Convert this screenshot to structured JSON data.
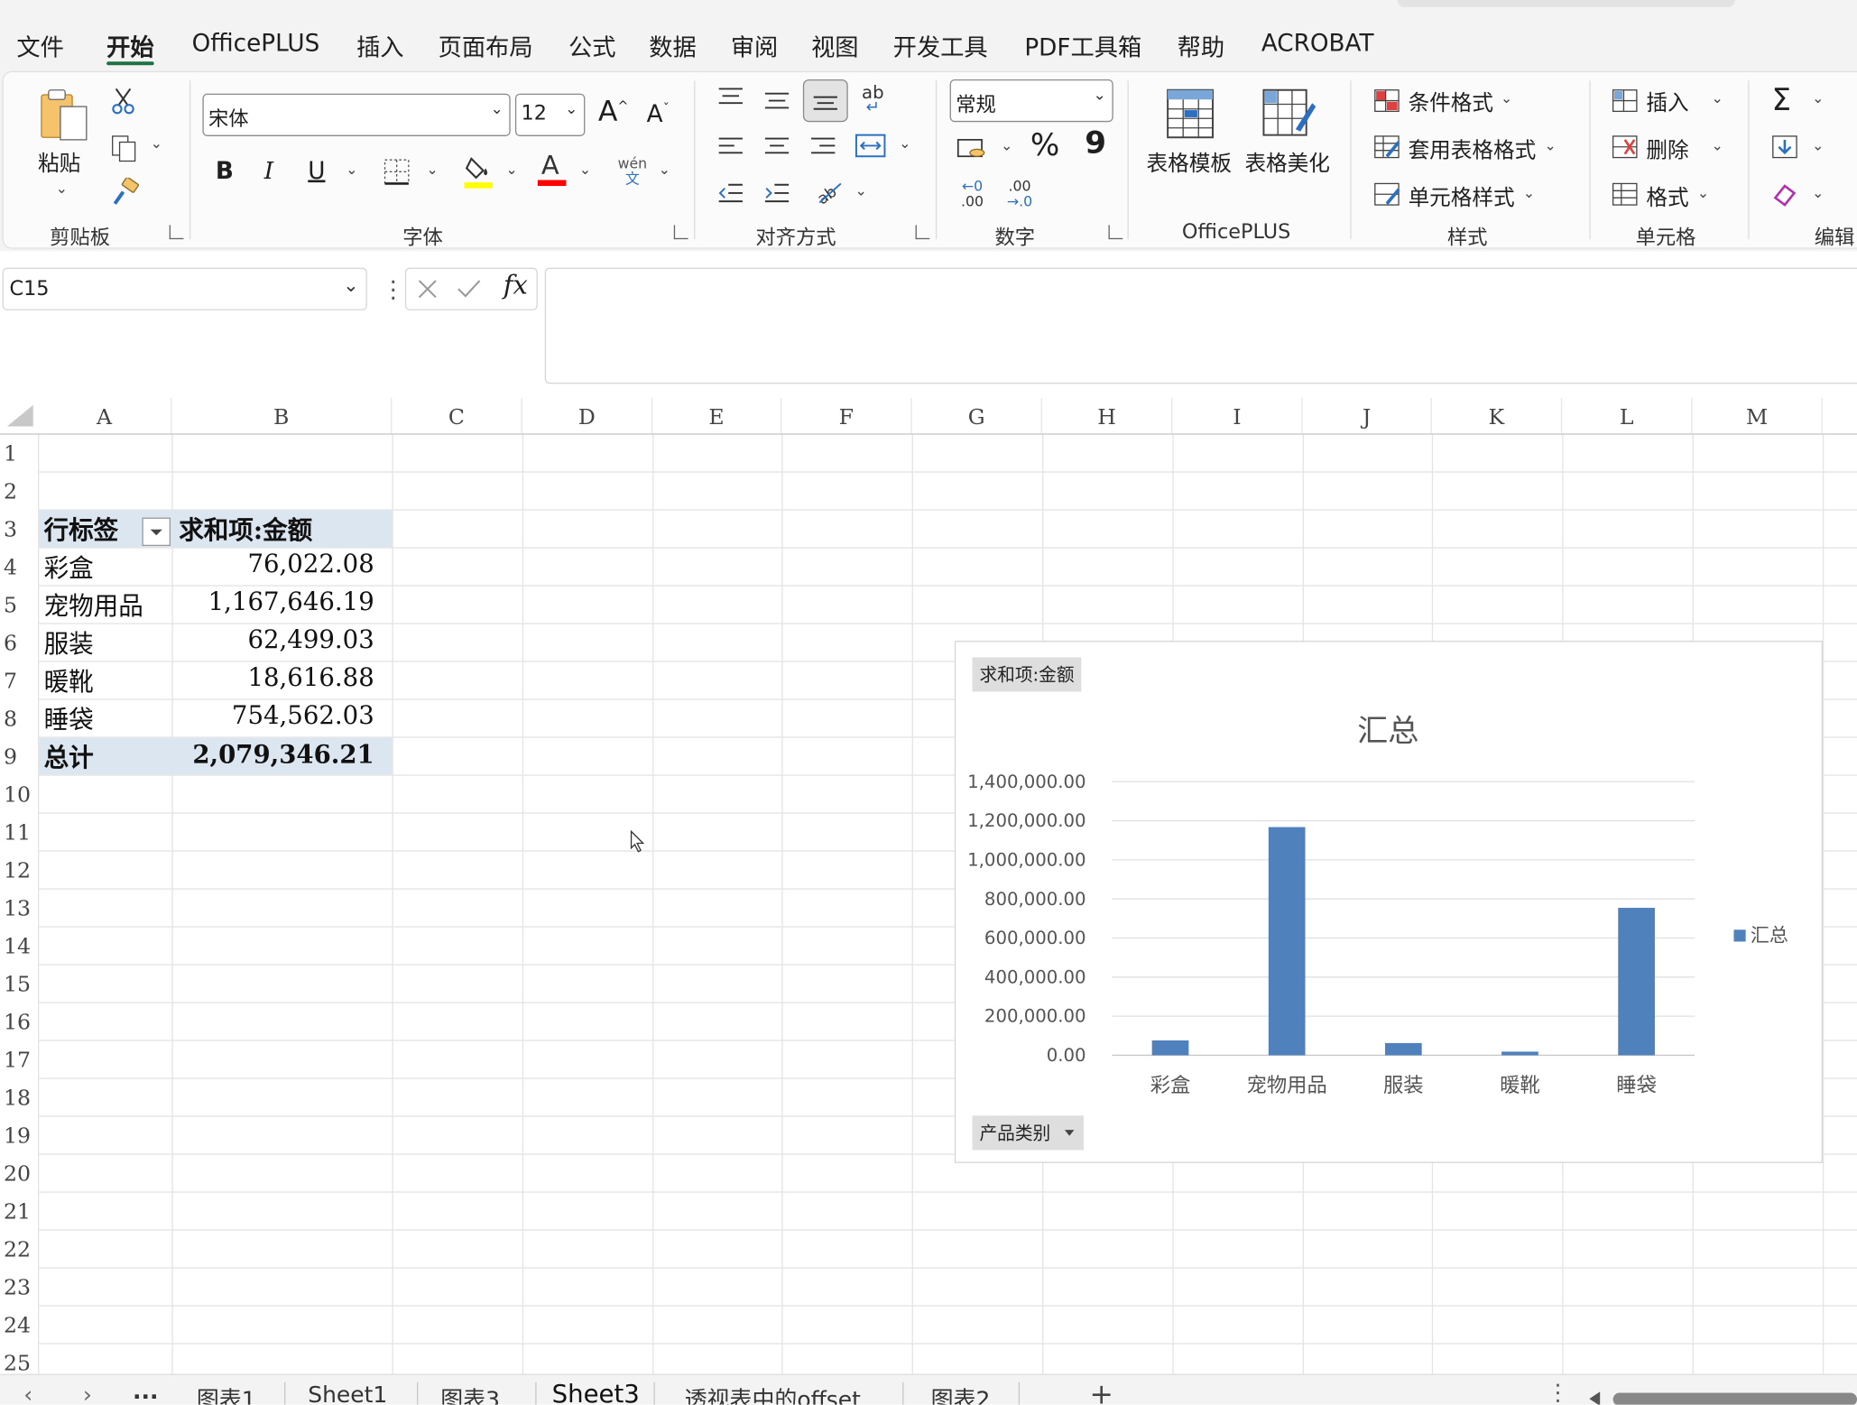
{
  "menu": {
    "items": [
      "文件",
      "开始",
      "OfficePLUS",
      "插入",
      "页面布局",
      "公式",
      "数据",
      "审阅",
      "视图",
      "开发工具",
      "PDF工具箱",
      "帮助",
      "ACROBAT"
    ],
    "active_index": 1
  },
  "ribbon": {
    "clipboard": {
      "paste_label": "粘贴",
      "group_label": "剪贴板"
    },
    "font": {
      "font_name": "宋体",
      "font_size": "12",
      "bold": "B",
      "italic": "I",
      "underline": "U",
      "font_color_glyph": "A",
      "phonetic_top": "wén",
      "phonetic_bottom": "文",
      "grow": "A",
      "shrink": "A",
      "group_label": "字体"
    },
    "alignment": {
      "wrap_glyph": "ab",
      "group_label": "对齐方式"
    },
    "number": {
      "format": "常规",
      "percent": "%",
      "comma": "9",
      "dec_inc_top": "←0",
      "dec_inc_bottom": ".00",
      "dec_dec_top": ".00",
      "dec_dec_bottom": "→.0",
      "group_label": "数字"
    },
    "officeplus": {
      "table_template": "表格模板",
      "table_beautify": "表格美化",
      "group_label": "OfficePLUS"
    },
    "styles": {
      "conditional": "条件格式",
      "table_format": "套用表格格式",
      "cell_styles": "单元格样式",
      "group_label": "样式"
    },
    "cells": {
      "insert": "插入",
      "delete": "删除",
      "format": "格式",
      "group_label": "单元格"
    },
    "editing": {
      "sum": "Σ",
      "group_label": "编辑"
    }
  },
  "formula_bar": {
    "name_box": "C15",
    "fx": "fx",
    "content": ""
  },
  "columns": [
    "A",
    "B",
    "C",
    "D",
    "E",
    "F",
    "G",
    "H",
    "I",
    "J",
    "K",
    "L",
    "M"
  ],
  "rows": [
    "1",
    "2",
    "3",
    "4",
    "5",
    "6",
    "7",
    "8",
    "9",
    "10",
    "11",
    "12",
    "13",
    "14",
    "15",
    "16",
    "17",
    "18",
    "19",
    "20",
    "21",
    "22",
    "23",
    "24",
    "25"
  ],
  "pivot": {
    "header_label": "行标签",
    "header_value": "求和项:金额",
    "rows": [
      {
        "label": "彩盒",
        "value": "76,022.08"
      },
      {
        "label": "宠物用品",
        "value": "1,167,646.19"
      },
      {
        "label": "服装",
        "value": "62,499.03"
      },
      {
        "label": "暖靴",
        "value": "18,616.88"
      },
      {
        "label": "睡袋",
        "value": "754,562.03"
      }
    ],
    "total_label": "总计",
    "total_value": "2,079,346.21",
    "header_fill": "#dce6f1"
  },
  "chart_data": {
    "type": "bar",
    "title": "汇总",
    "value_field_button": "求和项:金额",
    "axis_field_button": "产品类别",
    "categories": [
      "彩盒",
      "宠物用品",
      "服装",
      "暖靴",
      "睡袋"
    ],
    "series": [
      {
        "name": "汇总",
        "values": [
          76022.08,
          1167646.19,
          62499.03,
          18616.88,
          754562.03
        ],
        "color": "#4f81bd"
      }
    ],
    "y_ticks": [
      "0.00",
      "200,000.00",
      "400,000.00",
      "600,000.00",
      "800,000.00",
      "1,000,000.00",
      "1,200,000.00",
      "1,400,000.00"
    ],
    "ylim": [
      0,
      1400000
    ],
    "grid": true,
    "legend": "right"
  },
  "sheet_tabs": {
    "items": [
      "图表1",
      "Sheet1",
      "图表3",
      "Sheet3",
      "透视表中的offset",
      "图表2"
    ],
    "active_index": 3,
    "more": "...",
    "add": "+"
  }
}
